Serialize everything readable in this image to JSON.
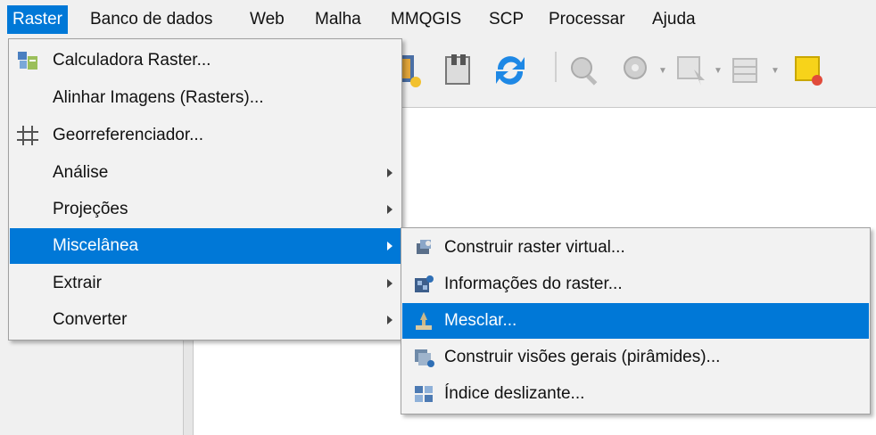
{
  "menubar": {
    "items": [
      {
        "label": "Raster",
        "active": true
      },
      {
        "label": "Banco de dados"
      },
      {
        "label": "Web"
      },
      {
        "label": "Malha"
      },
      {
        "label": "MMQGIS"
      },
      {
        "label": "SCP"
      },
      {
        "label": "Processar"
      },
      {
        "label": "Ajuda"
      }
    ]
  },
  "raster_menu": {
    "items": [
      {
        "label": "Calculadora Raster...",
        "icon": "raster-calculator-icon"
      },
      {
        "label": "Alinhar Imagens (Rasters)..."
      },
      {
        "label": "Georreferenciador...",
        "icon": "georeferencer-grid-icon"
      },
      {
        "label": "Análise",
        "submenu": true
      },
      {
        "label": "Projeções",
        "submenu": true
      },
      {
        "label": "Miscelânea",
        "submenu": true,
        "active": true
      },
      {
        "label": "Extrair",
        "submenu": true
      },
      {
        "label": "Converter",
        "submenu": true
      }
    ]
  },
  "misc_submenu": {
    "items": [
      {
        "label": "Construir raster virtual...",
        "icon": "build-virtual-raster-icon"
      },
      {
        "label": "Informações do raster...",
        "icon": "raster-info-icon"
      },
      {
        "label": "Mesclar...",
        "icon": "merge-icon",
        "active": true
      },
      {
        "label": "Construir visões gerais (pirâmides)...",
        "icon": "build-overviews-icon"
      },
      {
        "label": "Índice deslizante...",
        "icon": "tile-index-icon"
      }
    ]
  },
  "colors": {
    "highlight": "#0078d7",
    "menu_bg": "#f2f2f2"
  }
}
